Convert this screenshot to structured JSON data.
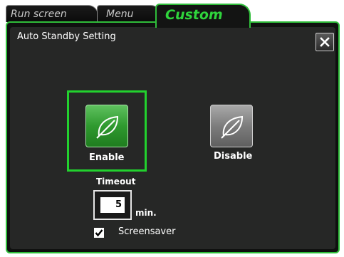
{
  "tabs": {
    "run_screen": "Run screen",
    "menu": "Menu",
    "custom": "Custom"
  },
  "dialog": {
    "title": "Auto Standby Setting",
    "close_icon": "close-icon"
  },
  "options": {
    "enable_label": "Enable",
    "disable_label": "Disable",
    "selected": "Enable",
    "icon": "leaf-icon"
  },
  "timeout": {
    "label": "Timeout",
    "value": "5",
    "unit": "min."
  },
  "screensaver": {
    "label": "Screensaver",
    "checked": true
  },
  "colors": {
    "accent": "#2fbd3a",
    "selection": "#22d12e",
    "panel_bg": "#262726"
  }
}
